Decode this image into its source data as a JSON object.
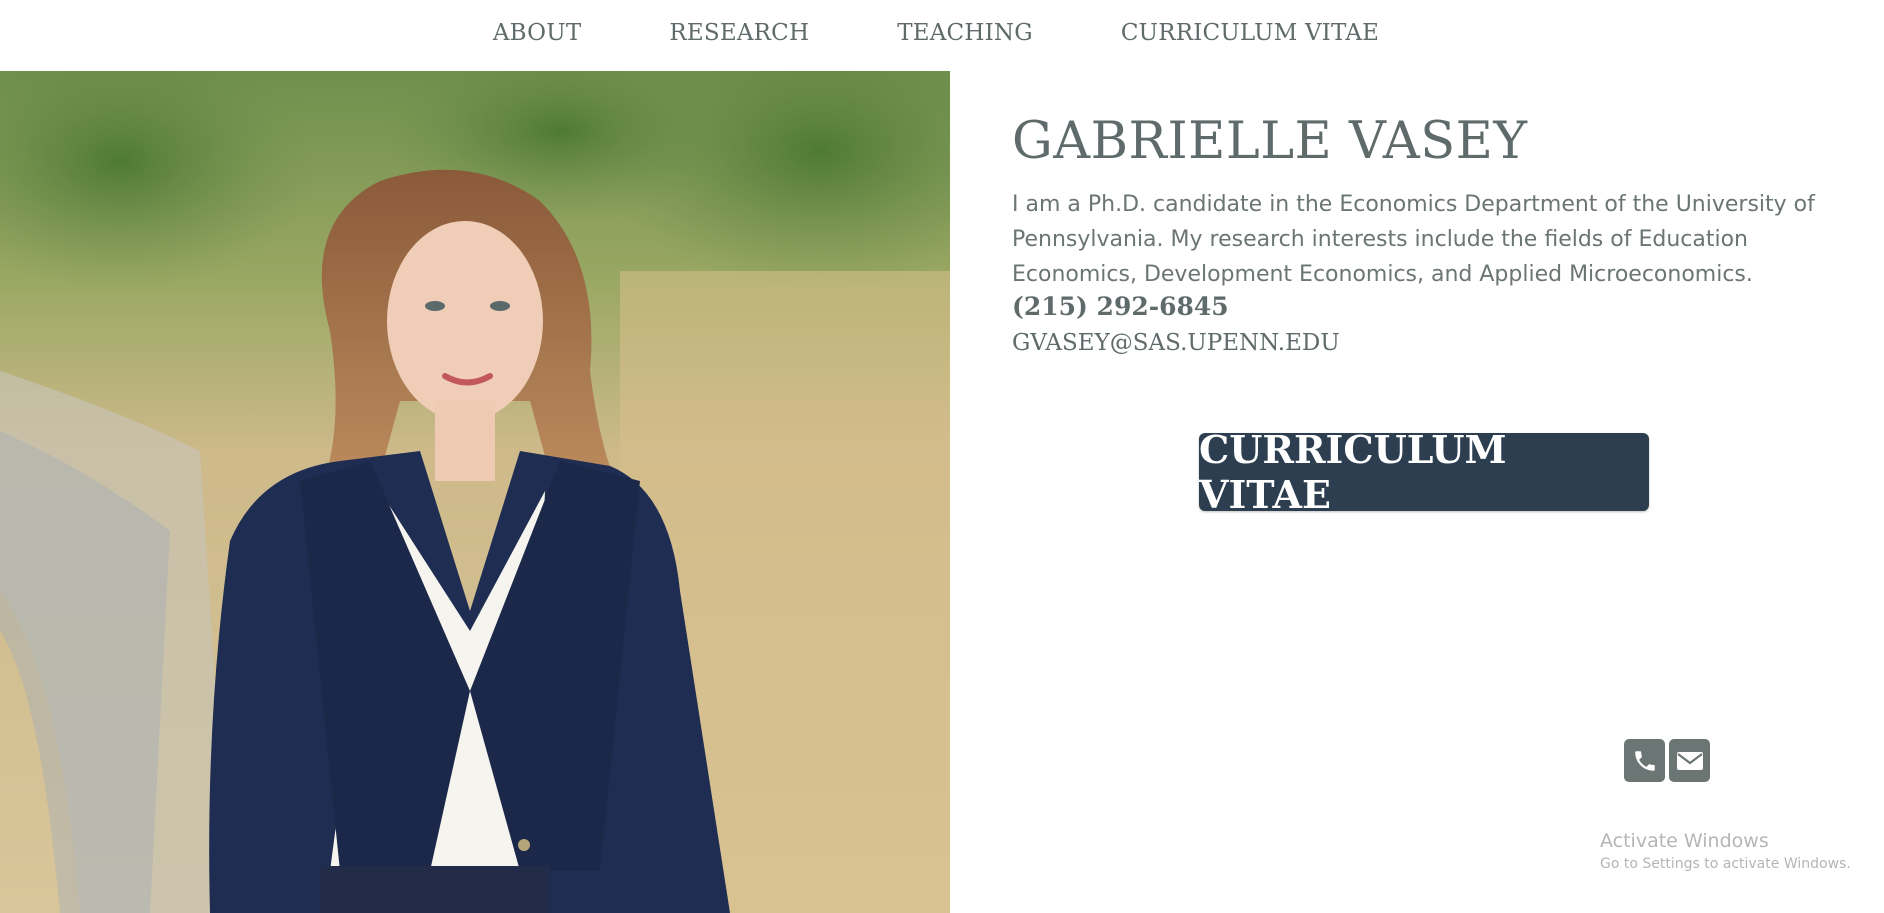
{
  "nav": {
    "items": [
      {
        "label": "ABOUT"
      },
      {
        "label": "RESEARCH"
      },
      {
        "label": "TEACHING"
      },
      {
        "label": "CURRICULUM VITAE"
      }
    ]
  },
  "profile": {
    "name": "GABRIELLE VASEY",
    "bio": "I am a Ph.D. candidate in the Economics Department of the University of Pennsylvania. My research interests include the fields of Education Economics, Development Economics, and Applied Microeconomics.",
    "phone": "(215) 292-6845",
    "email": "GVASEY@SAS.UPENN.EDU"
  },
  "cv_button": {
    "label": "CURRICULUM VITAE"
  },
  "social": {
    "icons": [
      "phone-icon",
      "envelope-icon"
    ]
  },
  "watermark": {
    "title": "Activate Windows",
    "subtitle": "Go to Settings to activate Windows."
  },
  "colors": {
    "text": "#5f6b6a",
    "button_bg": "#2d3e50",
    "icon_bg": "#6b7574"
  }
}
